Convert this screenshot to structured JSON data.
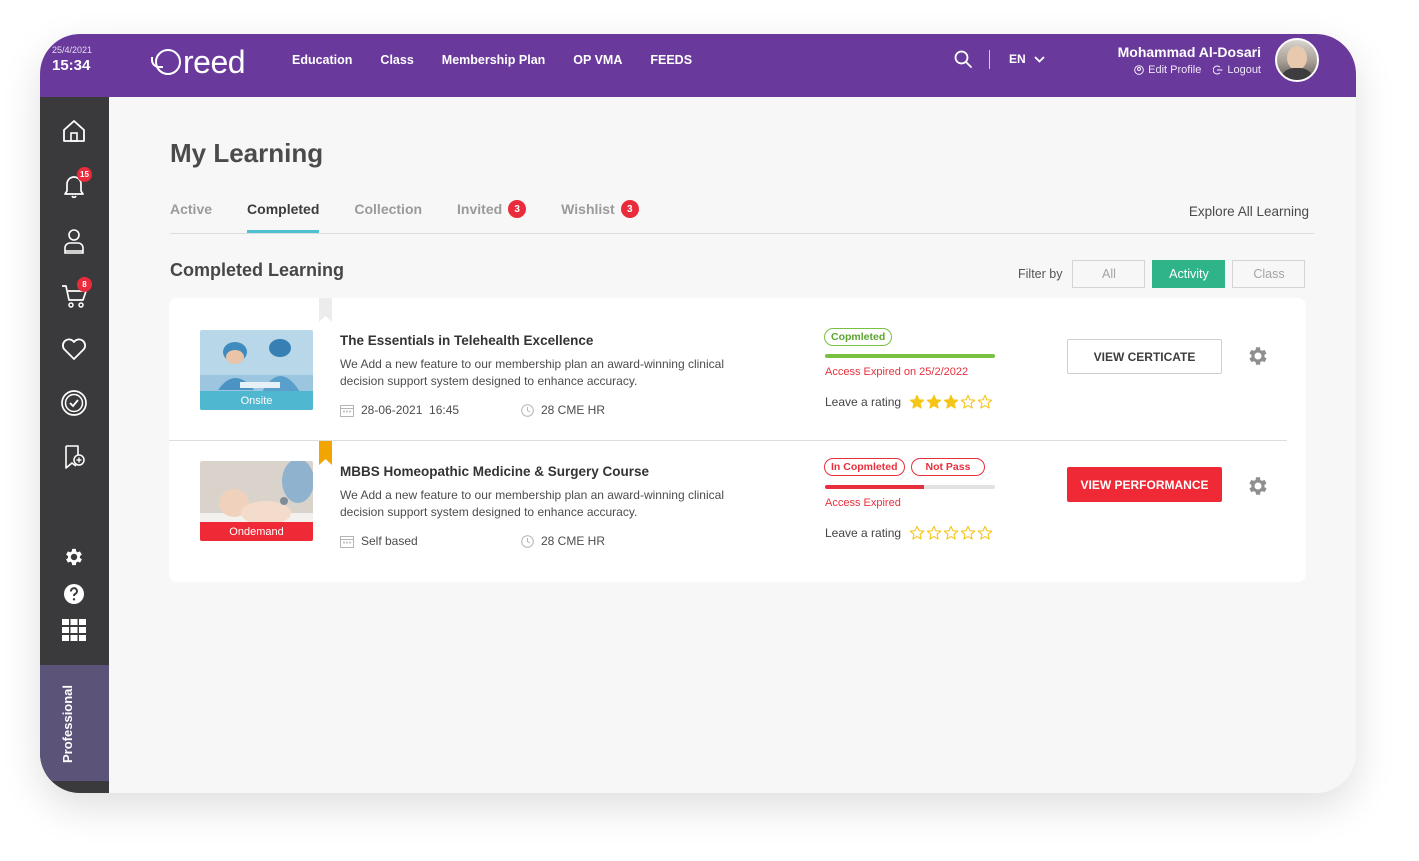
{
  "header": {
    "date": "25/4/2021",
    "time": "15:34",
    "logo": "reed",
    "nav": [
      "Education",
      "Class",
      "Membership Plan",
      "OP VMA",
      "FEEDS"
    ],
    "language": "EN",
    "user_name": "Mohammad Al-Dosari",
    "edit_profile": "Edit Profile",
    "logout": "Logout"
  },
  "sidebar": {
    "notification_count": "15",
    "cart_count": "8",
    "plan_label": "Professional"
  },
  "page": {
    "title": "My Learning",
    "tabs": [
      {
        "label": "Active"
      },
      {
        "label": "Completed",
        "active": true
      },
      {
        "label": "Collection"
      },
      {
        "label": "Invited",
        "badge": "3"
      },
      {
        "label": "Wishlist",
        "badge": "3"
      }
    ],
    "explore_link": "Explore All Learning",
    "section_title": "Completed Learning",
    "filter": {
      "label": "Filter by",
      "options": [
        "All",
        "Activity",
        "Class"
      ],
      "selected": "Activity"
    }
  },
  "courses": [
    {
      "title": "The Essentials in Telehealth Excellence",
      "description": "We Add a new feature to our membership plan an award-winning clinical decision support system designed to enhance accuracy.",
      "type": "Onsite",
      "schedule": "28-06-2021  16:45",
      "cme": "28 CME HR",
      "status": "Copmleted",
      "progress": 1.0,
      "access": "Access Expired on 25/2/2022",
      "rating_label": "Leave a rating",
      "rating": 3,
      "action": "VIEW CERTICATE"
    },
    {
      "title": "MBBS Homeopathic Medicine & Surgery Course",
      "description": "We Add a new feature to our membership plan an award-winning clinical decision support system designed to enhance accuracy.",
      "type": "Ondemand",
      "schedule": "Self based",
      "cme": "28 CME HR",
      "status": "In Copmleted",
      "result": "Not Pass",
      "progress": 0.58,
      "access": "Access Expired",
      "rating_label": "Leave a rating",
      "rating": 0,
      "action": "VIEW PERFORMANCE"
    }
  ],
  "colors": {
    "brand_purple": "#693a9c",
    "sidebar": "#3a3a3c",
    "accent_green": "#2fb389",
    "completed_green": "#7ac143",
    "alert_red": "#ef2a36",
    "star_yellow": "#f5c518",
    "tab_underline": "#4ec0d4"
  }
}
